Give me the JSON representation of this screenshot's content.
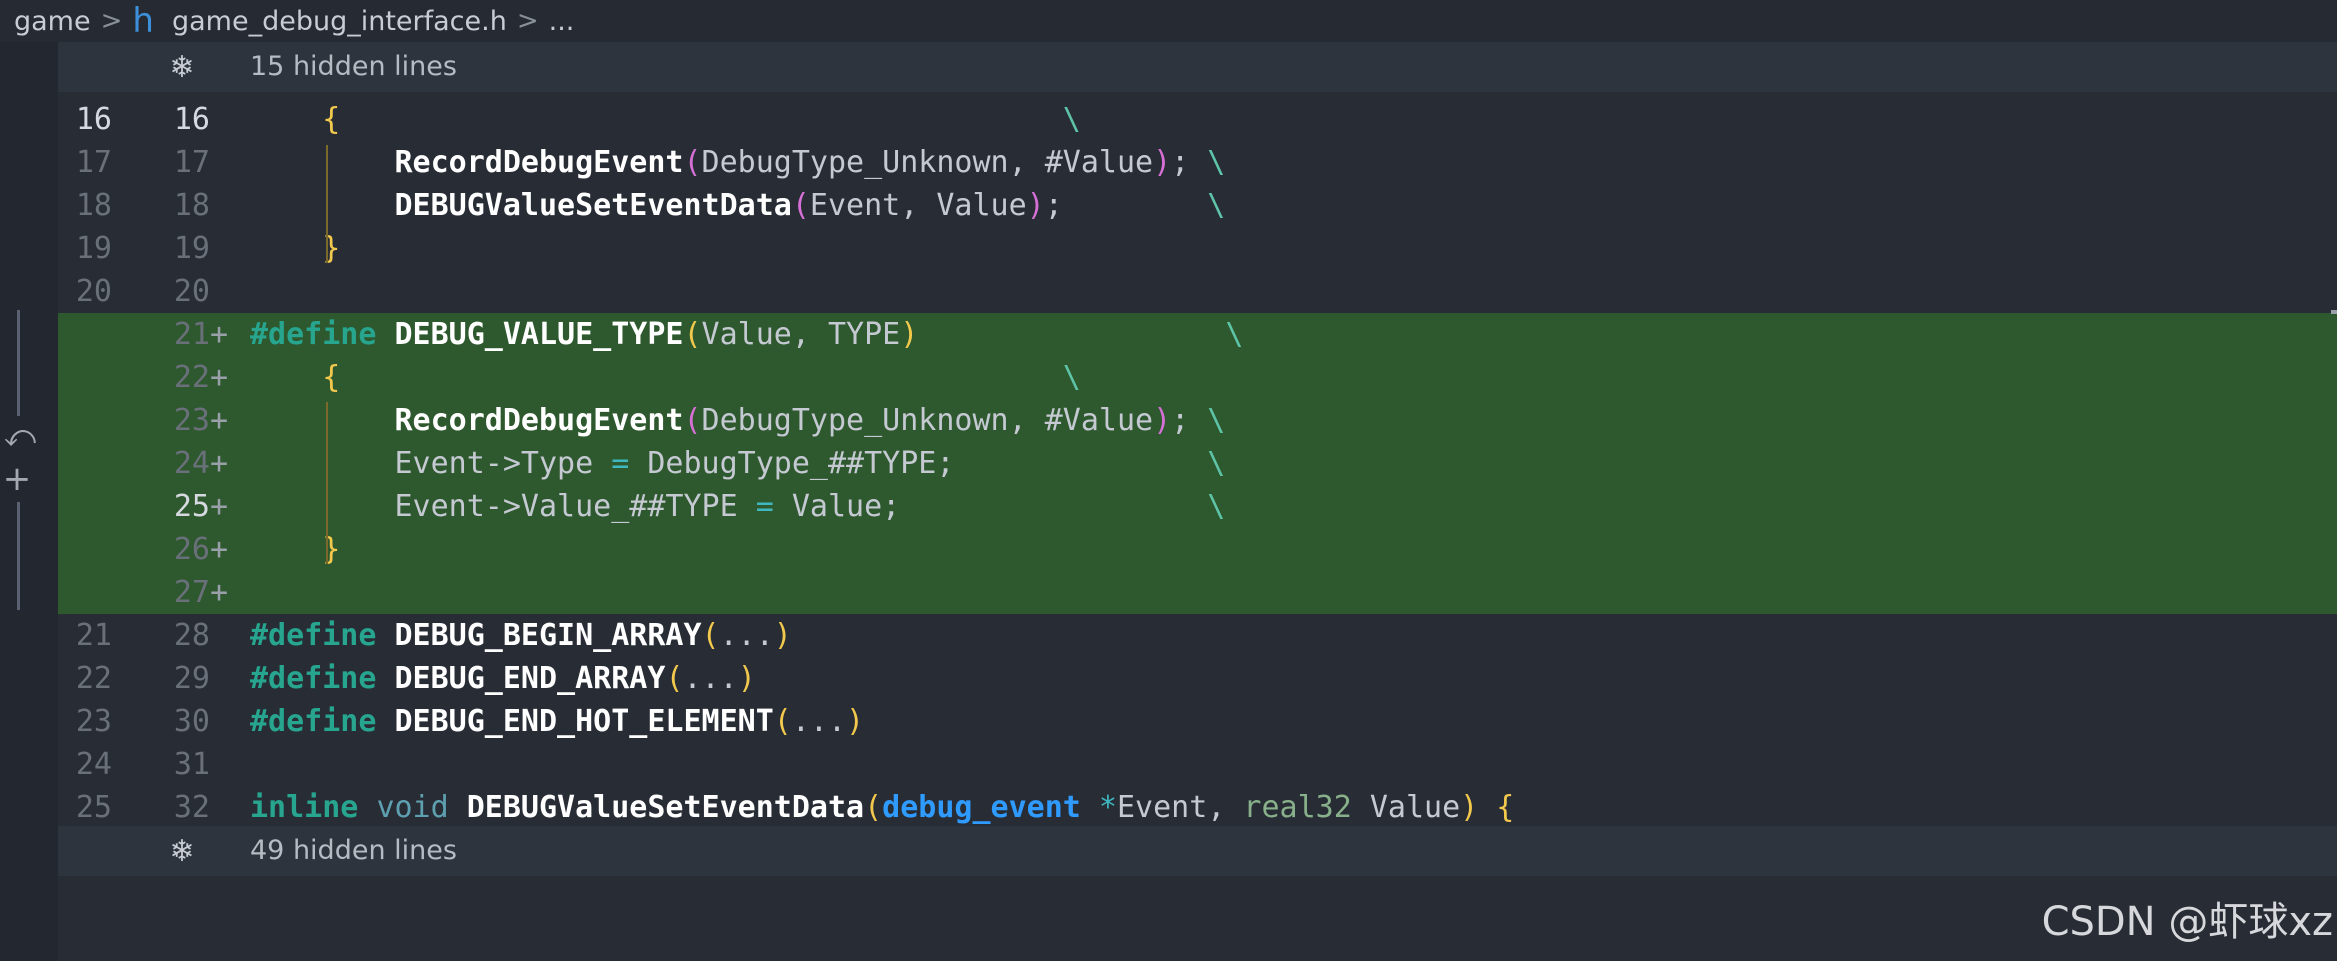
{
  "breadcrumb": {
    "folder": "game",
    "sep1": ">",
    "file_icon": "h",
    "file": "game_debug_interface.h",
    "sep2": ">",
    "more": "..."
  },
  "fold_top": {
    "icon": "fold-expand-icon",
    "label": "15 hidden lines"
  },
  "fold_bottom": {
    "icon": "fold-expand-icon",
    "label": "49 hidden lines"
  },
  "lines": [
    {
      "old": "16",
      "new": "16",
      "plus": "",
      "added": false,
      "current": true,
      "segs": [
        [
          "id",
          "    "
        ],
        [
          "br",
          "{"
        ],
        [
          "id",
          "                                        "
        ],
        [
          "bs",
          "\\"
        ]
      ]
    },
    {
      "old": "17",
      "new": "17",
      "plus": "",
      "added": false,
      "segs": [
        [
          "id",
          "        "
        ],
        [
          "fn",
          "RecordDebugEvent"
        ],
        [
          "p2",
          "("
        ],
        [
          "id",
          "DebugType_Unknown, #Value"
        ],
        [
          "p2",
          ")"
        ],
        [
          "id",
          "; "
        ],
        [
          "bs",
          "\\"
        ]
      ]
    },
    {
      "old": "18",
      "new": "18",
      "plus": "",
      "added": false,
      "segs": [
        [
          "id",
          "        "
        ],
        [
          "fn",
          "DEBUGValueSetEventData"
        ],
        [
          "p2",
          "("
        ],
        [
          "id",
          "Event, Value"
        ],
        [
          "p2",
          ")"
        ],
        [
          "id",
          ";        "
        ],
        [
          "bs",
          "\\"
        ]
      ]
    },
    {
      "old": "19",
      "new": "19",
      "plus": "",
      "added": false,
      "segs": [
        [
          "id",
          "    "
        ],
        [
          "br",
          "}"
        ]
      ]
    },
    {
      "old": "20",
      "new": "20",
      "plus": "",
      "added": false,
      "segs": []
    },
    {
      "old": "",
      "new": "21",
      "plus": "+",
      "added": true,
      "segs": [
        [
          "kw",
          "#define"
        ],
        [
          "id",
          " "
        ],
        [
          "fn",
          "DEBUG_VALUE_TYPE"
        ],
        [
          "br",
          "("
        ],
        [
          "id",
          "Value, TYPE"
        ],
        [
          "br",
          ")"
        ],
        [
          "id",
          "                 "
        ],
        [
          "bs",
          "\\"
        ]
      ]
    },
    {
      "old": "",
      "new": "22",
      "plus": "+",
      "added": true,
      "segs": [
        [
          "id",
          "    "
        ],
        [
          "br",
          "{"
        ],
        [
          "id",
          "                                        "
        ],
        [
          "bs",
          "\\"
        ]
      ]
    },
    {
      "old": "",
      "new": "23",
      "plus": "+",
      "added": true,
      "segs": [
        [
          "id",
          "        "
        ],
        [
          "fn",
          "RecordDebugEvent"
        ],
        [
          "p2",
          "("
        ],
        [
          "id",
          "DebugType_Unknown, #Value"
        ],
        [
          "p2",
          ")"
        ],
        [
          "id",
          "; "
        ],
        [
          "bs",
          "\\"
        ]
      ]
    },
    {
      "old": "",
      "new": "24",
      "plus": "+",
      "added": true,
      "segs": [
        [
          "id",
          "        Event->Type "
        ],
        [
          "op",
          "="
        ],
        [
          "id",
          " DebugType_##TYPE;              "
        ],
        [
          "bs",
          "\\"
        ]
      ]
    },
    {
      "old": "",
      "new": "25",
      "plus": "+",
      "added": true,
      "current": true,
      "segs": [
        [
          "id",
          "        Event->Value_##TYPE "
        ],
        [
          "op",
          "="
        ],
        [
          "id",
          " Value;                 "
        ],
        [
          "bs",
          "\\"
        ]
      ]
    },
    {
      "old": "",
      "new": "26",
      "plus": "+",
      "added": true,
      "segs": [
        [
          "id",
          "    "
        ],
        [
          "br",
          "}"
        ]
      ]
    },
    {
      "old": "",
      "new": "27",
      "plus": "+",
      "added": true,
      "segs": []
    },
    {
      "old": "21",
      "new": "28",
      "plus": "",
      "added": false,
      "segs": [
        [
          "kw",
          "#define"
        ],
        [
          "id",
          " "
        ],
        [
          "fn",
          "DEBUG_BEGIN_ARRAY"
        ],
        [
          "br",
          "("
        ],
        [
          "id",
          "..."
        ],
        [
          "br",
          ")"
        ]
      ]
    },
    {
      "old": "22",
      "new": "29",
      "plus": "",
      "added": false,
      "segs": [
        [
          "kw",
          "#define"
        ],
        [
          "id",
          " "
        ],
        [
          "fn",
          "DEBUG_END_ARRAY"
        ],
        [
          "br",
          "("
        ],
        [
          "id",
          "..."
        ],
        [
          "br",
          ")"
        ]
      ]
    },
    {
      "old": "23",
      "new": "30",
      "plus": "",
      "added": false,
      "segs": [
        [
          "kw",
          "#define"
        ],
        [
          "id",
          " "
        ],
        [
          "fn",
          "DEBUG_END_HOT_ELEMENT"
        ],
        [
          "br",
          "("
        ],
        [
          "id",
          "..."
        ],
        [
          "br",
          ")"
        ]
      ]
    },
    {
      "old": "24",
      "new": "31",
      "plus": "",
      "added": false,
      "segs": []
    },
    {
      "old": "25",
      "new": "32",
      "plus": "",
      "added": false,
      "segs": [
        [
          "kw",
          "inline"
        ],
        [
          "id",
          " "
        ],
        [
          "vo",
          "void"
        ],
        [
          "id",
          " "
        ],
        [
          "fn",
          "DEBUGValueSetEventData"
        ],
        [
          "br",
          "("
        ],
        [
          "ty",
          "debug_event"
        ],
        [
          "id",
          " "
        ],
        [
          "op",
          "*"
        ],
        [
          "id",
          "Event, "
        ],
        [
          "r32",
          "real32"
        ],
        [
          "id",
          " Value"
        ],
        [
          "br",
          ")"
        ],
        [
          "id",
          " "
        ],
        [
          "br",
          "{"
        ]
      ]
    }
  ],
  "gutter_actions": {
    "revert_icon": "revert-icon",
    "add_icon": "plus-icon"
  },
  "watermark": "CSDN @虾球xz",
  "colors": {
    "added_line_bg": "#2e582e",
    "keyword": "#27a58f",
    "bracket": "#f2c94c",
    "paren_nested": "#d670d6",
    "type": "#2f9bff",
    "backslash": "#5ec4a7"
  }
}
